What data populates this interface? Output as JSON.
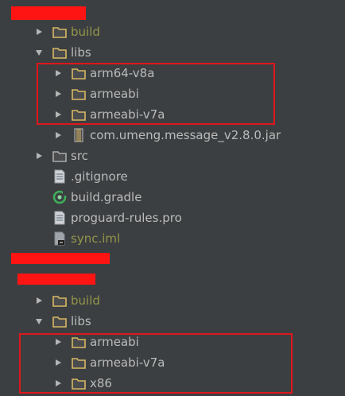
{
  "colors": {
    "background": "#3c3f41",
    "text": "#bbbbbb",
    "excluded_text": "#94944a",
    "folder_fill": "#4a4c4e",
    "folder_stroke": "#d9b863",
    "highlight_box": "#e0161c",
    "redaction": "#ff1414"
  },
  "tree": {
    "top_section": {
      "build_folder": {
        "label": "build",
        "icon": "folder-icon",
        "expanded": false,
        "excluded": true
      },
      "libs_folder": {
        "label": "libs",
        "icon": "folder-icon",
        "expanded": true
      },
      "libs_children": [
        {
          "label": "arm64-v8a",
          "icon": "folder-icon"
        },
        {
          "label": "armeabi",
          "icon": "folder-icon"
        },
        {
          "label": "armeabi-v7a",
          "icon": "folder-icon"
        }
      ],
      "jar_file": {
        "label": "com.umeng.message_v2.8.0.jar",
        "icon": "jar-icon"
      },
      "src_folder": {
        "label": "src",
        "icon": "folder-icon"
      },
      "gitignore_file": {
        "label": ".gitignore",
        "icon": "text-file-icon"
      },
      "build_gradle_file": {
        "label": "build.gradle",
        "icon": "gradle-icon"
      },
      "proguard_file": {
        "label": "proguard-rules.pro",
        "icon": "text-file-icon"
      },
      "iml_file": {
        "label": "sync.iml",
        "icon": "iml-file-icon",
        "excluded": true
      }
    },
    "bottom_section": {
      "build_folder": {
        "label": "build",
        "icon": "folder-icon",
        "expanded": false,
        "excluded": true
      },
      "libs_folder": {
        "label": "libs",
        "icon": "folder-icon",
        "expanded": true
      },
      "libs_children": [
        {
          "label": "armeabi",
          "icon": "folder-icon"
        },
        {
          "label": "armeabi-v7a",
          "icon": "folder-icon"
        },
        {
          "label": "x86",
          "icon": "folder-icon"
        }
      ]
    }
  }
}
